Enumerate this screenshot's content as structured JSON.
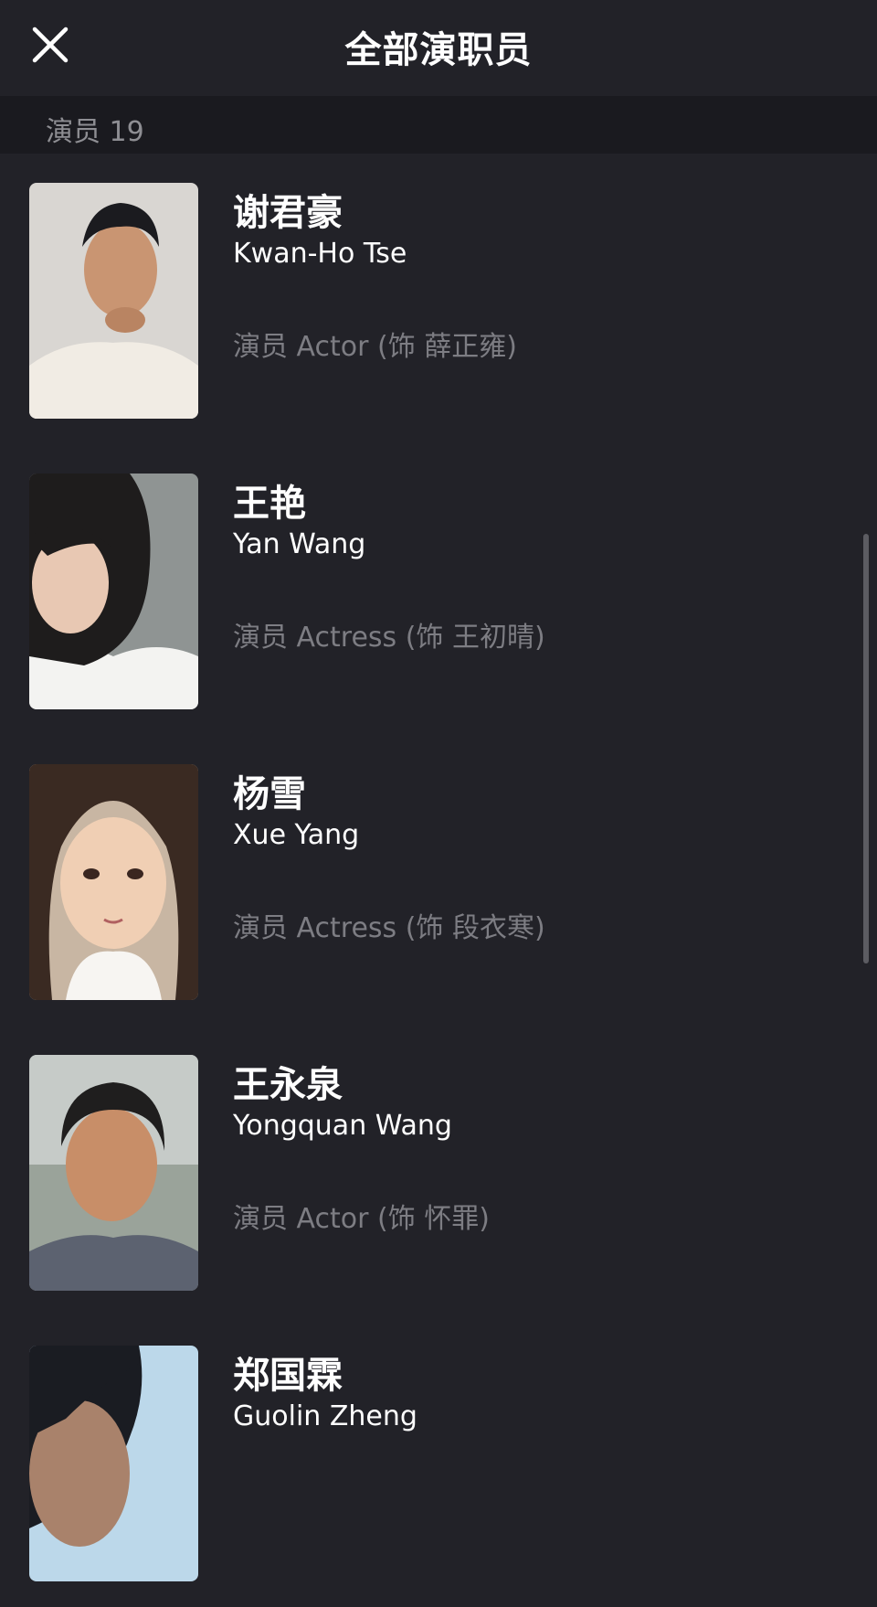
{
  "nav": {
    "title": "全部演职员",
    "close_icon": "close-icon"
  },
  "section": {
    "label": "演员 19"
  },
  "cast": [
    {
      "name_cn": "谢君豪",
      "name_en": "Kwan-Ho Tse",
      "role": "演员 Actor (饰 薛正雍)"
    },
    {
      "name_cn": "王艳",
      "name_en": "Yan Wang",
      "role": "演员 Actress (饰 王初晴)"
    },
    {
      "name_cn": "杨雪",
      "name_en": "Xue Yang",
      "role": "演员 Actress (饰 段衣寒)"
    },
    {
      "name_cn": "王永泉",
      "name_en": "Yongquan Wang",
      "role": "演员 Actor (饰 怀罪)"
    },
    {
      "name_cn": "郑国霖",
      "name_en": "Guolin Zheng",
      "role": ""
    }
  ],
  "colors": {
    "background": "#222228",
    "section_background": "#1a1a1f",
    "primary_text": "#ffffff",
    "secondary_text": "#7d7d83"
  }
}
